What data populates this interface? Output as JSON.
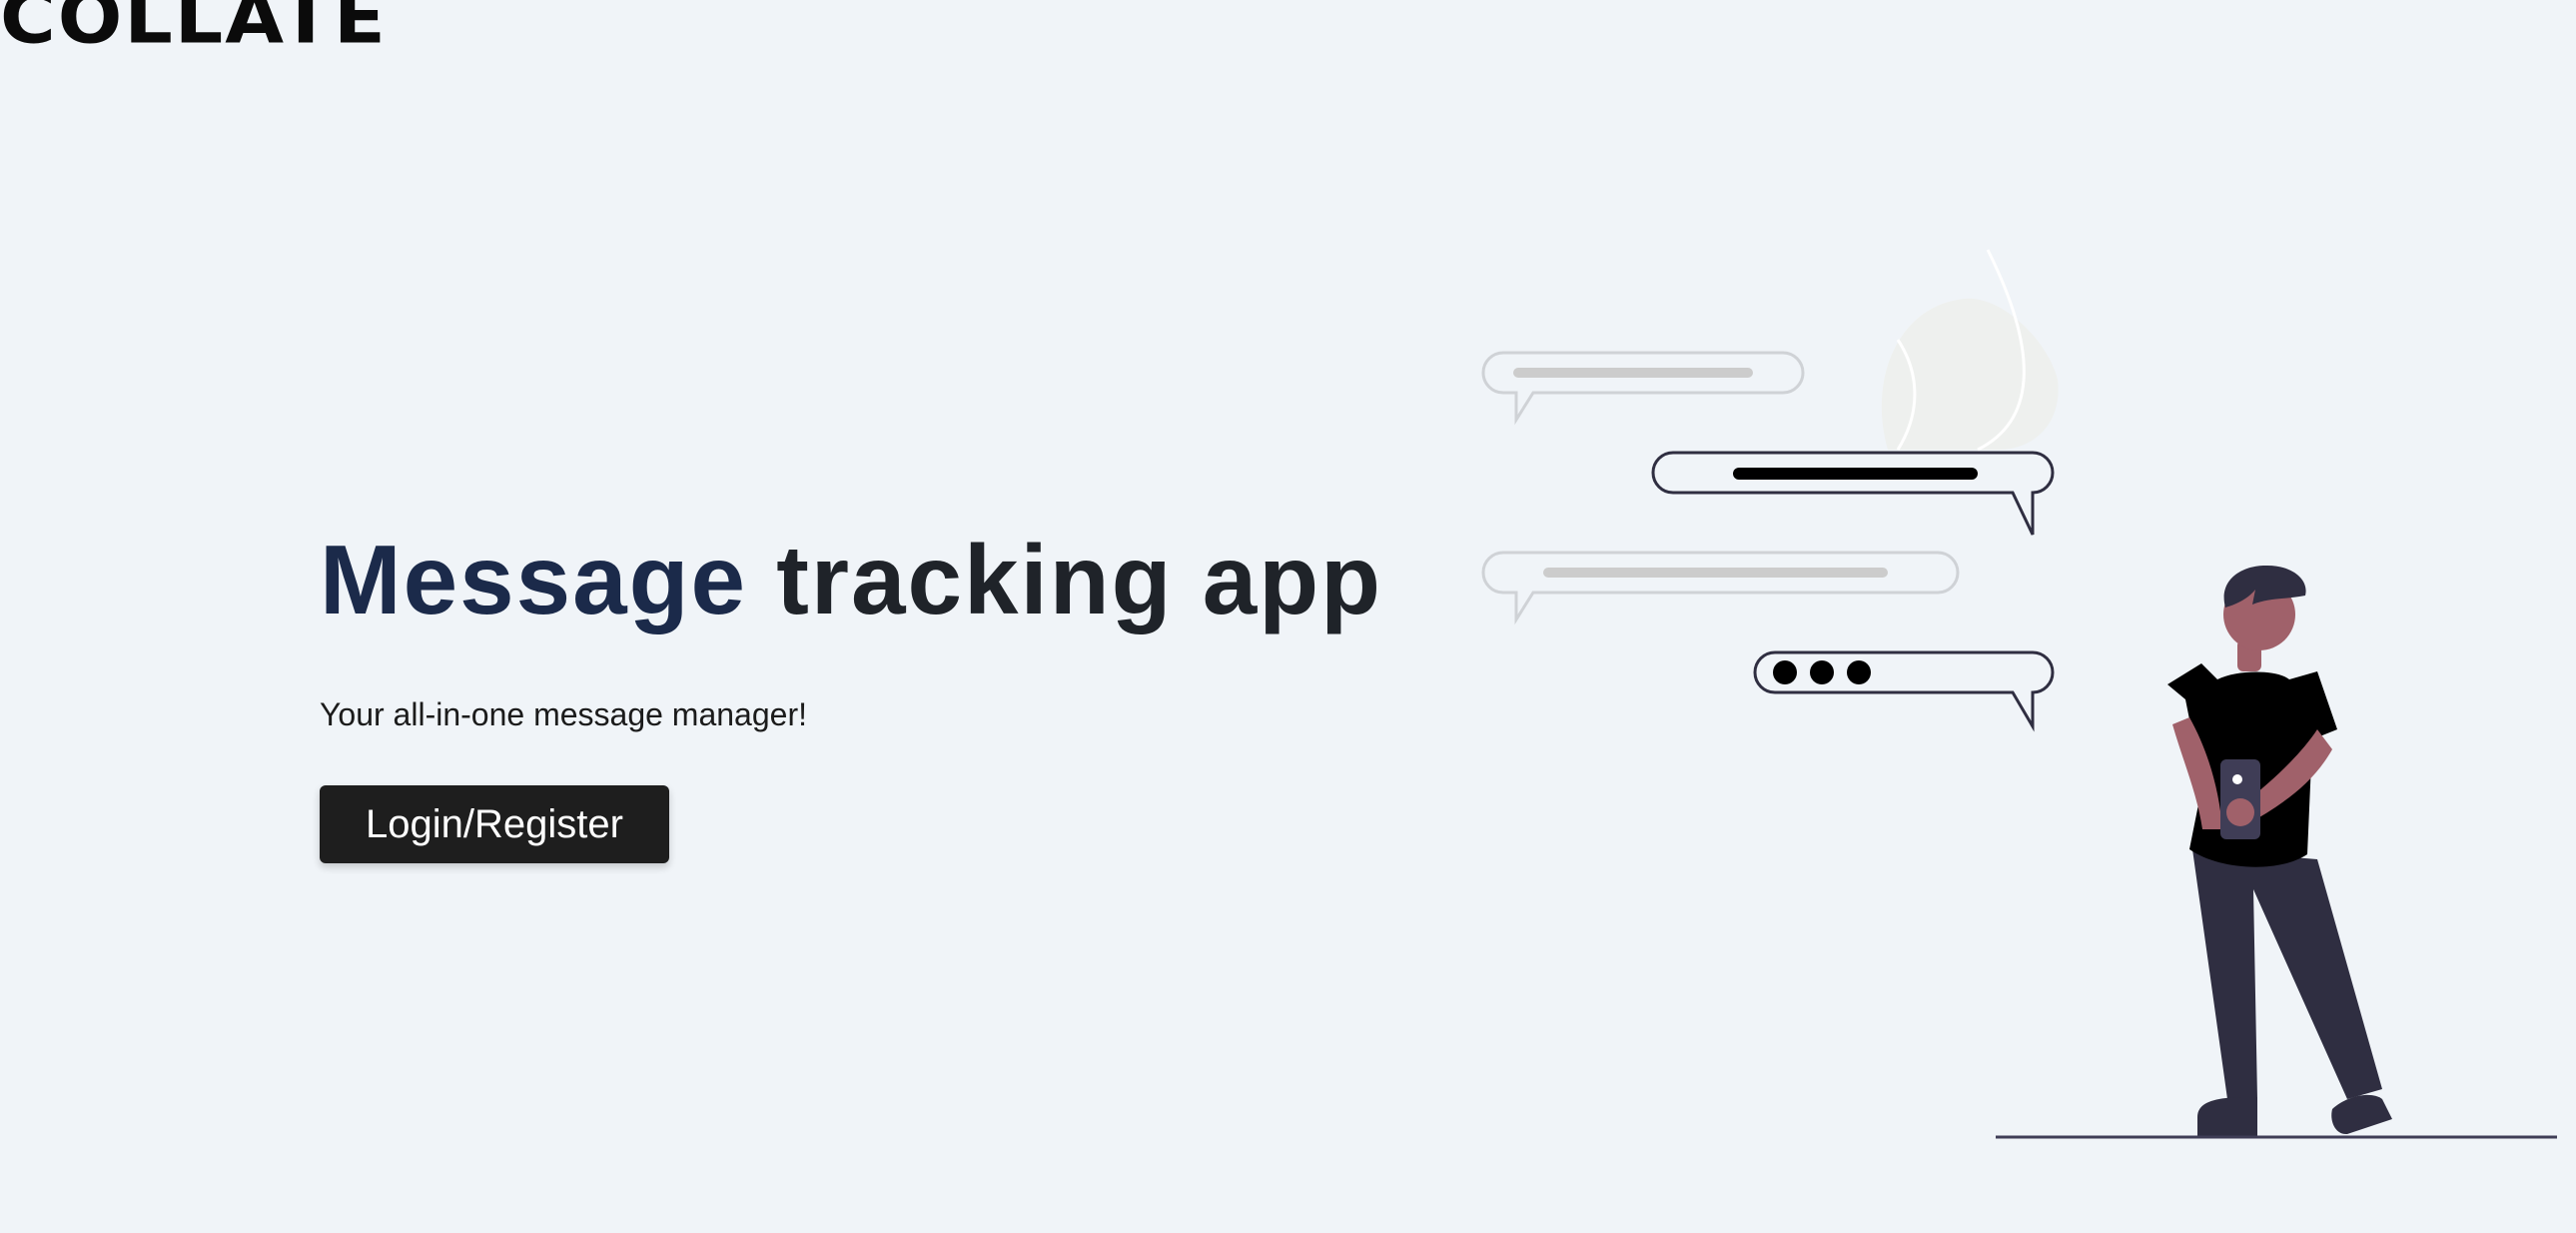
{
  "brand": {
    "logo_text": "COLLATE"
  },
  "hero": {
    "title_first": "Message",
    "title_rest": " tracking app",
    "subtitle": "Your all-in-one message manager!",
    "cta_label": "Login/Register"
  },
  "colors": {
    "background": "#f0f4f8",
    "title_accent": "#1b2a4a",
    "button_background": "#1e1e1e",
    "skin": "#a0616a",
    "dark_outline": "#2f2e41"
  }
}
